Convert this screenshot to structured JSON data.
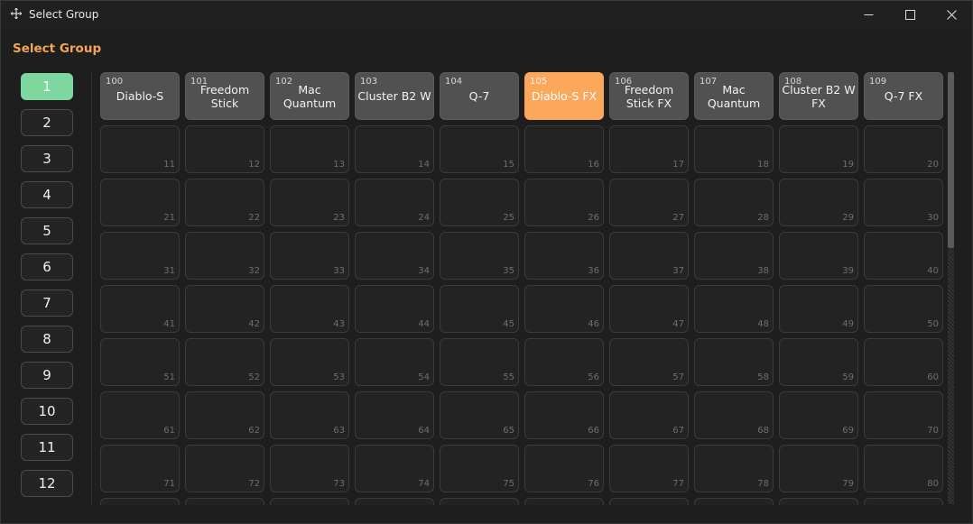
{
  "window": {
    "title": "Select Group",
    "icon": "move-icon"
  },
  "header": {
    "title": "Select Group"
  },
  "sidebar": {
    "pages": [
      "1",
      "2",
      "3",
      "4",
      "5",
      "6",
      "7",
      "8",
      "9",
      "10",
      "11",
      "12"
    ],
    "active_index": 0
  },
  "grid": {
    "groups": [
      {
        "id": "100",
        "name": "Diablo-S"
      },
      {
        "id": "101",
        "name": "Freedom Stick"
      },
      {
        "id": "102",
        "name": "Mac Quantum"
      },
      {
        "id": "103",
        "name": "Cluster B2 W"
      },
      {
        "id": "104",
        "name": "Q-7"
      },
      {
        "id": "105",
        "name": "Diablo-S FX"
      },
      {
        "id": "106",
        "name": "Freedom Stick FX"
      },
      {
        "id": "107",
        "name": "Mac Quantum"
      },
      {
        "id": "108",
        "name": "Cluster B2 W FX"
      },
      {
        "id": "109",
        "name": "Q-7 FX"
      }
    ],
    "selected_index": 5,
    "empty_slots": [
      "11",
      "12",
      "13",
      "14",
      "15",
      "16",
      "17",
      "18",
      "19",
      "20",
      "21",
      "22",
      "23",
      "24",
      "25",
      "26",
      "27",
      "28",
      "29",
      "30",
      "31",
      "32",
      "33",
      "34",
      "35",
      "36",
      "37",
      "38",
      "39",
      "40",
      "41",
      "42",
      "43",
      "44",
      "45",
      "46",
      "47",
      "48",
      "49",
      "50",
      "51",
      "52",
      "53",
      "54",
      "55",
      "56",
      "57",
      "58",
      "59",
      "60",
      "61",
      "62",
      "63",
      "64",
      "65",
      "66",
      "67",
      "68",
      "69",
      "70",
      "71",
      "72",
      "73",
      "74",
      "75",
      "76",
      "77",
      "78",
      "79",
      "80"
    ]
  },
  "colors": {
    "accent_orange": "#fba85d",
    "active_green": "#7fd7a0",
    "header_orange": "#f0a653"
  }
}
